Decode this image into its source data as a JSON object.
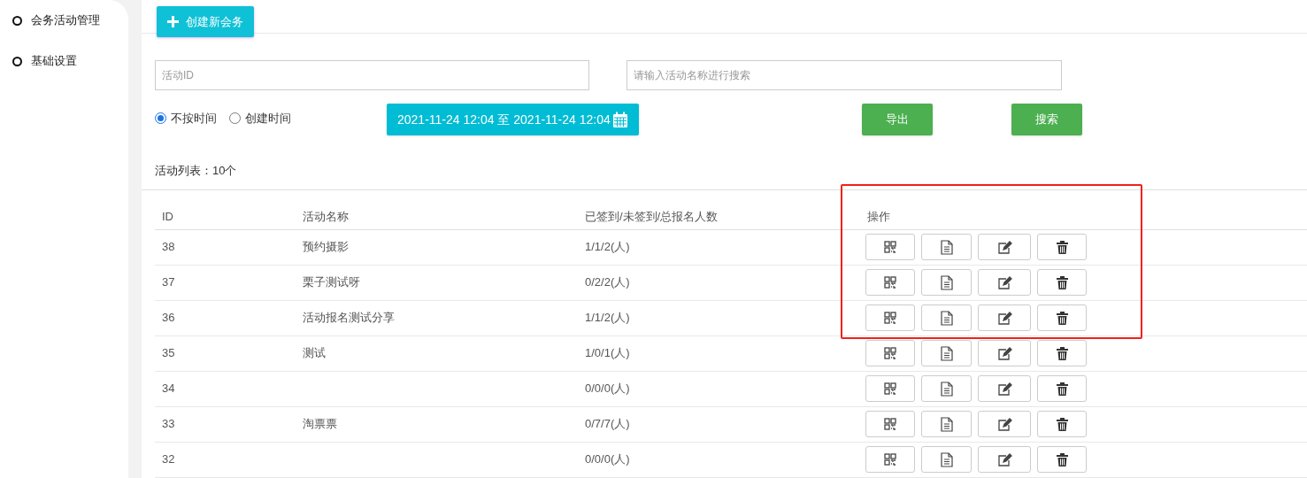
{
  "sidebar": {
    "items": [
      {
        "label": "会务活动管理"
      },
      {
        "label": "基础设置"
      }
    ]
  },
  "toolbar": {
    "create_button": "创建新会务"
  },
  "filters": {
    "id_field": {
      "placeholder": "活动ID"
    },
    "name_field": {
      "placeholder": "请输入活动名称进行搜索"
    },
    "time_options": [
      {
        "label": "不按时间",
        "selected": true
      },
      {
        "label": "创建时间",
        "selected": false
      }
    ],
    "date_range": "2021-11-24 12:04 至 2021-11-24 12:04",
    "export_button": "导出",
    "search_button": "搜索"
  },
  "list_summary": "活动列表：10个",
  "table": {
    "columns": [
      "ID",
      "活动名称",
      "已签到/未签到/总报名人数",
      "操作"
    ],
    "rows": [
      {
        "id": "38",
        "name": "预约摄影",
        "counts": "1/1/2(人)"
      },
      {
        "id": "37",
        "name": "栗子测试呀",
        "counts": "0/2/2(人)"
      },
      {
        "id": "36",
        "name": "活动报名测试分享",
        "counts": "1/1/2(人)"
      },
      {
        "id": "35",
        "name": "测试",
        "counts": "1/0/1(人)"
      },
      {
        "id": "34",
        "counts": "0/0/0(人)"
      },
      {
        "id": "33",
        "name": "淘票票",
        "counts": "0/7/7(人)"
      },
      {
        "id": "32",
        "counts": "0/0/0(人)"
      }
    ]
  }
}
